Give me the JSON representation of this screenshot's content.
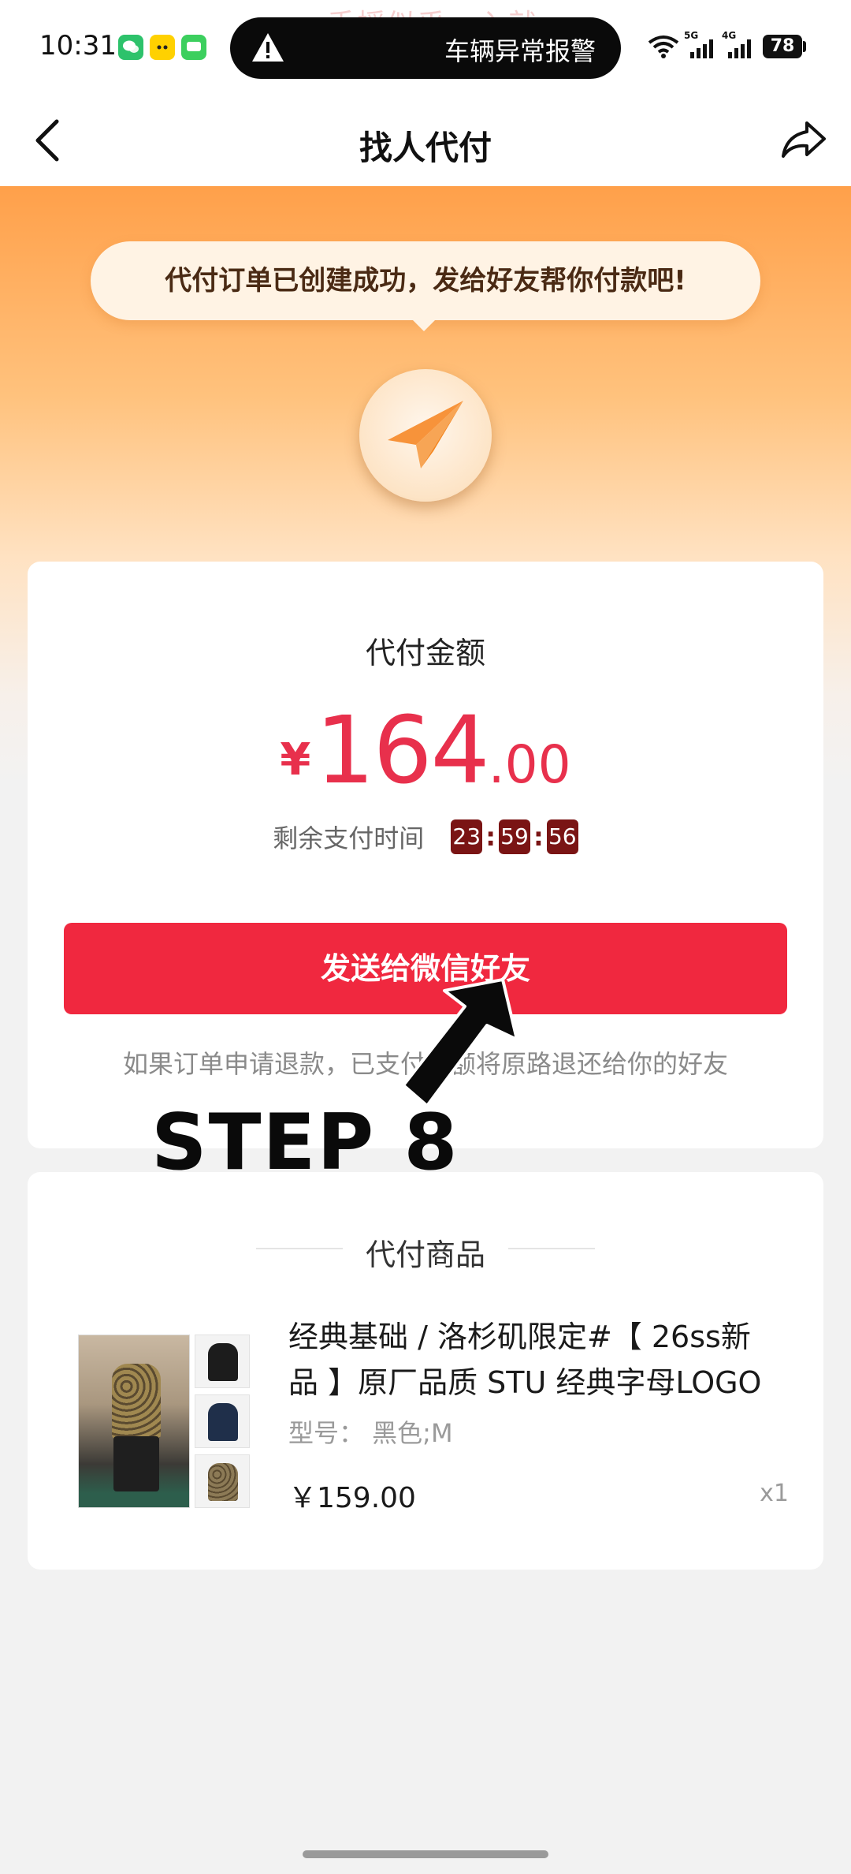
{
  "status_bar": {
    "time": "10:31",
    "faded_text": "手摇似乎 · 入就",
    "notification": "车辆异常报警",
    "network_1": "5G",
    "network_2": "4G",
    "battery": "78",
    "icons": [
      "wechat-icon",
      "meituan-icon",
      "message-icon",
      "warning-icon",
      "wifi-icon",
      "signal-icon",
      "battery-icon"
    ]
  },
  "nav": {
    "title": "找人代付",
    "back_icon": "chevron-left-icon",
    "share_icon": "share-icon"
  },
  "hero": {
    "tip": "代付订单已创建成功，发给好友帮你付款吧!",
    "badge_icon": "paper-plane-icon"
  },
  "payment": {
    "label": "代付金额",
    "currency": "¥",
    "amount_int": "164",
    "amount_dec": ".00",
    "countdown_label": "剩余支付时间",
    "countdown": {
      "hours": "23",
      "minutes": "59",
      "seconds": "56"
    },
    "send_button": "发送给微信好友",
    "refund_note": "如果订单申请退款，已支付金额将原路退还给你的好友"
  },
  "annotation": {
    "step": "STEP 8"
  },
  "goods": {
    "header": "代付商品",
    "items": [
      {
        "title": "经典基础 / 洛杉矶限定#【 26ss新品 】原厂品质 STU 经典字母LOGO",
        "spec": "型号：  黑色;M",
        "price": "￥159.00",
        "qty": "x1"
      }
    ]
  },
  "colors": {
    "accent_red": "#f0283f",
    "price_red": "#e8304c",
    "countdown_bg": "#7a1414",
    "hero_orange": "#ffa04a"
  }
}
